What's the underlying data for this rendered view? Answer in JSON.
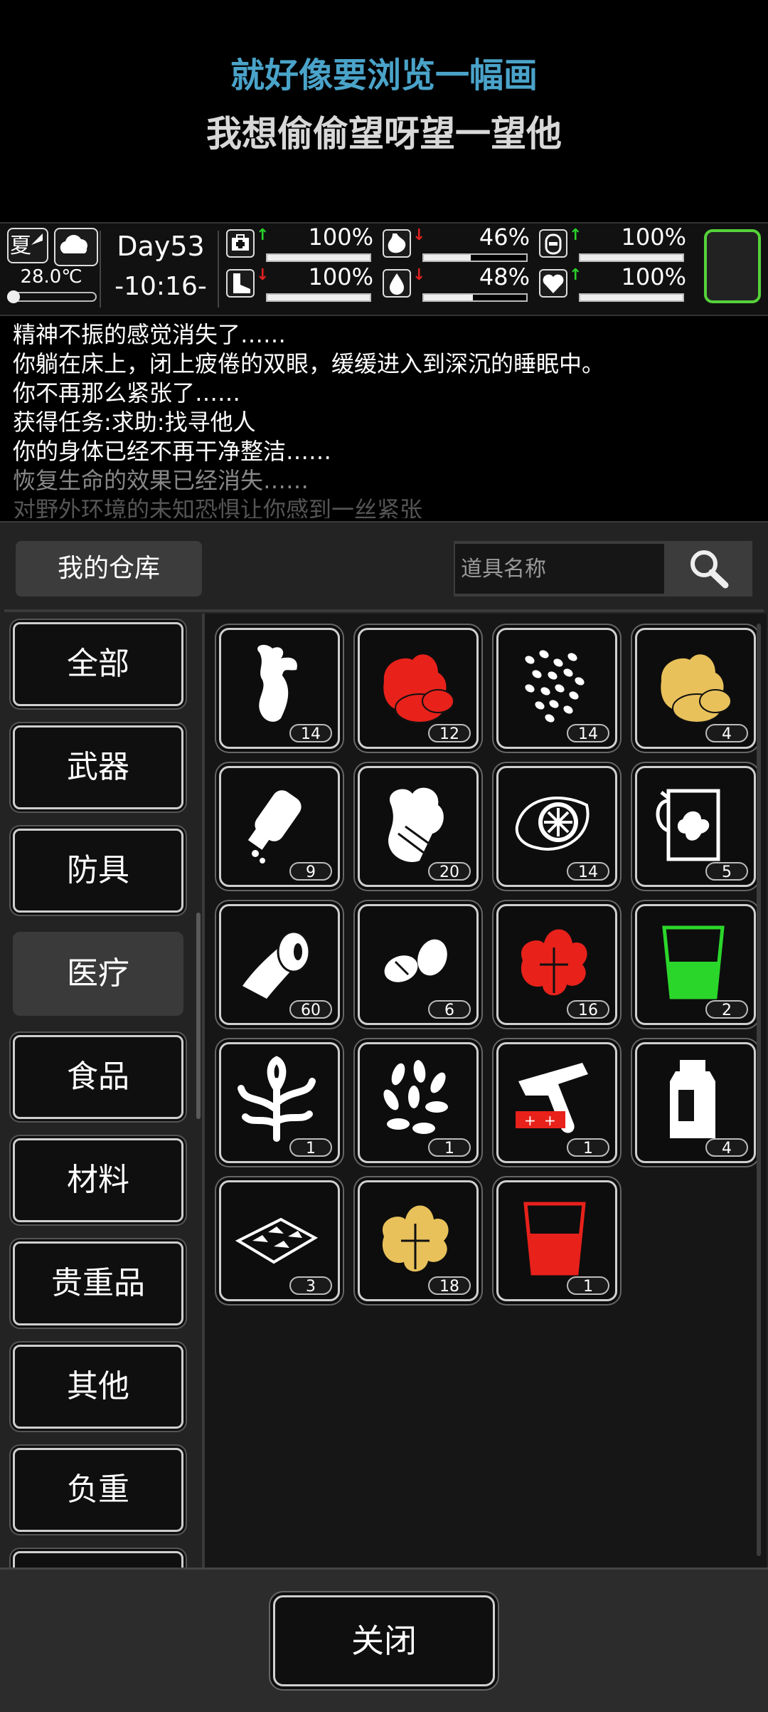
{
  "lyrics": {
    "line1": "就好像要浏览一幅画",
    "line2": "我想偷偷望呀望一望他"
  },
  "status": {
    "season": "夏",
    "weather_icon": "cloud-icon",
    "temperature": "28.0℃",
    "day": "Day53",
    "time": "-10:16-",
    "stats": [
      {
        "icon": "medkit-icon",
        "trend": "up",
        "value_pct": "100%",
        "level": 1.0
      },
      {
        "icon": "stomach-icon",
        "trend": "down",
        "value_pct": "46%",
        "level": 0.46
      },
      {
        "icon": "mood-icon",
        "trend": "up",
        "value_pct": "100%",
        "level": 1.0
      },
      {
        "icon": "foot-icon",
        "trend": "down",
        "value_pct": "100%",
        "level": 1.0
      },
      {
        "icon": "water-drop-icon",
        "trend": "down",
        "value_pct": "48%",
        "level": 0.48
      },
      {
        "icon": "heart-icon",
        "trend": "up",
        "value_pct": "100%",
        "level": 1.0
      }
    ],
    "colors": {
      "up": "#2ad12a",
      "down": "#e02020",
      "slot_border": "#55d23a"
    }
  },
  "log": [
    "精神不振的感觉消失了……",
    "你躺在床上，闭上疲倦的双眼，缓缓进入到深沉的睡眠中。",
    "你不再那么紧张了……",
    "获得任务:求助:找寻他人",
    "你的身体已经不再干净整洁……",
    "恢复生命的效果已经消失……",
    "对野外环境的未知恐惧让你感到一丝紧张"
  ],
  "warehouse": {
    "title": "我的仓库",
    "search_placeholder": "道具名称",
    "categories": [
      "全部",
      "武器",
      "防具",
      "医疗",
      "食品",
      "材料",
      "贵重品",
      "其他",
      "负重"
    ],
    "active_category": "医疗",
    "items": [
      {
        "icon": "ginseng-root-icon",
        "count": "14"
      },
      {
        "icon": "red-herb-leaves-icon",
        "count": "12"
      },
      {
        "icon": "seeds-icon",
        "count": "14"
      },
      {
        "icon": "yellow-herb-leaves-icon",
        "count": "4"
      },
      {
        "icon": "spray-bottle-icon",
        "count": "9"
      },
      {
        "icon": "herb-bundle-icon",
        "count": "20"
      },
      {
        "icon": "lemon-slice-icon",
        "count": "14"
      },
      {
        "icon": "herbal-jug-icon",
        "count": "5"
      },
      {
        "icon": "bandage-roll-icon",
        "count": "60"
      },
      {
        "icon": "nuts-icon",
        "count": "6"
      },
      {
        "icon": "red-leaf-plant-icon",
        "count": "16"
      },
      {
        "icon": "green-potion-cup-icon",
        "count": "2"
      },
      {
        "icon": "wild-plant-icon",
        "count": "1"
      },
      {
        "icon": "leaf-sprigs-icon",
        "count": "1"
      },
      {
        "icon": "flare-gun-icon",
        "count": "1"
      },
      {
        "icon": "medicine-bottle-icon",
        "count": "4"
      },
      {
        "icon": "pill-tray-icon",
        "count": "3"
      },
      {
        "icon": "yellow-herb-plant-icon",
        "count": "18"
      },
      {
        "icon": "red-potion-cup-icon",
        "count": "1"
      }
    ],
    "close_label": "关闭"
  }
}
